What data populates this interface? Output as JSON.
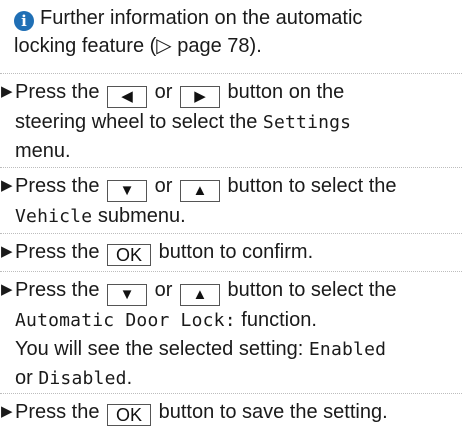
{
  "info": {
    "icon": "i",
    "text_line1": "Further information on the automatic",
    "text_line2_prefix": "locking feature (",
    "page_ref_symbol": "▷",
    "text_line2_suffix": " page 78)."
  },
  "steps": [
    {
      "bullet": "▶",
      "press": "Press the",
      "key_left": "◀",
      "or": "or",
      "key_right": "▶",
      "after_keys": "button on the",
      "line2_prefix": "steering wheel to select the ",
      "menu_name": "Settings",
      "line3": "menu."
    },
    {
      "bullet": "▶",
      "press": "Press the",
      "key_down": "▼",
      "or": "or",
      "key_up": "▲",
      "after_keys": "button to select the",
      "submenu_name": "Vehicle",
      "submenu_suffix": " submenu."
    },
    {
      "bullet": "▶",
      "press": "Press the",
      "key_ok": "OK",
      "after": "button to confirm."
    },
    {
      "bullet": "▶",
      "press": "Press the",
      "key_down": "▼",
      "or": "or",
      "key_up": "▲",
      "after_keys": "button to select the",
      "function_name": "Automatic Door Lock:",
      "function_suffix": " function.",
      "see_text": "You will see the selected setting: ",
      "setting_enabled": "Enabled",
      "or_word": "or ",
      "setting_disabled": "Disabled",
      "period": "."
    },
    {
      "bullet": "▶",
      "press": "Press the",
      "key_ok": "OK",
      "after": "button to save the setting."
    }
  ],
  "colors": {
    "info_icon": "#1f6fb5",
    "text": "#1a1a1a",
    "divider": "#bdbdbd"
  }
}
